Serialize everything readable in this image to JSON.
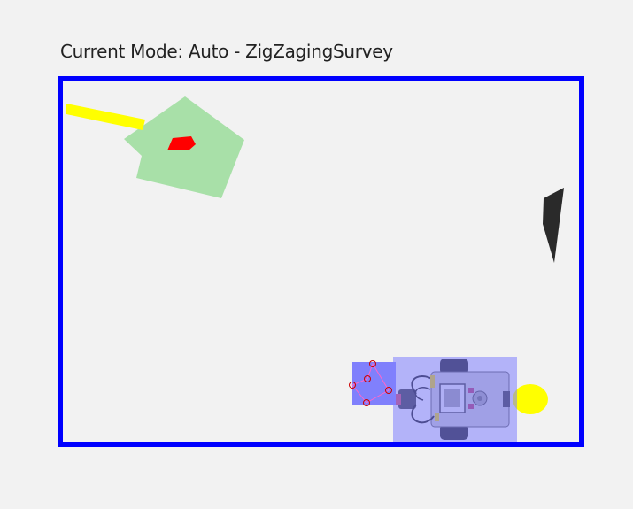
{
  "mode": {
    "prefix": "Current Mode:",
    "text": "Current Mode: Auto - ZigZagingSurvey"
  },
  "colors": {
    "background": "#f2f2f2",
    "arena_border": "#0000ff",
    "zone": "#a8e0a8",
    "zone_marker": "#ff0000",
    "beam": "#ffff00",
    "obstacle": "#2a2a2a",
    "robot_box": "#8080ff",
    "sensor_box": "#5a5aff",
    "sensor_points": "#cc0000",
    "robot_light": "#ffff00"
  },
  "icons": {
    "robot": "lego-ev3-robot-icon",
    "obstacle": "dark-obstacle-shape",
    "zone": "green-target-zone",
    "marker": "red-marker",
    "light": "yellow-light-beam"
  }
}
